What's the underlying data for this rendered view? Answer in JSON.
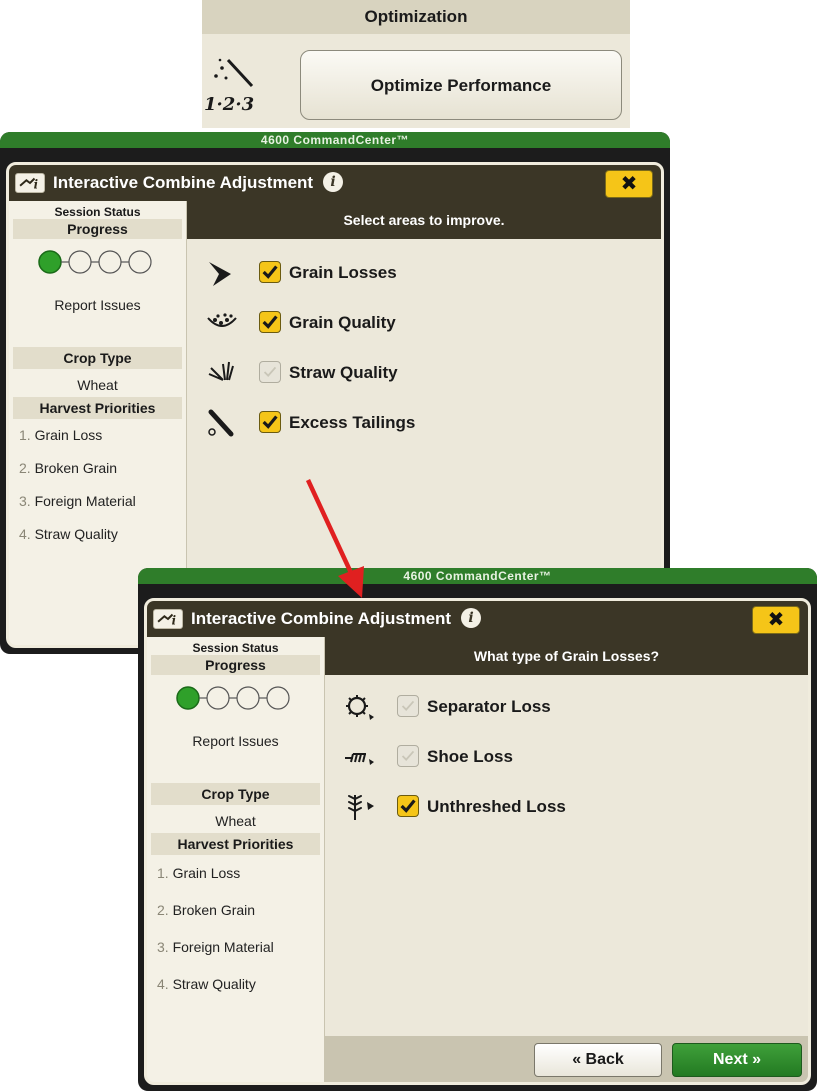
{
  "optimization": {
    "header": "Optimization",
    "button_label": "Optimize Performance",
    "icon": "magic-wand-123-icon",
    "icon_text": "1·2·3"
  },
  "screen1": {
    "commandcenter": "4600 CommandCenter™",
    "title": "Interactive Combine Adjustment",
    "close": "✖",
    "sidebar": {
      "session_status": "Session Status",
      "progress": "Progress",
      "step": "Report Issues",
      "crop_type_label": "Crop Type",
      "crop_type_value": "Wheat",
      "priorities_label": "Harvest Priorities",
      "priorities": [
        {
          "num": "1.",
          "label": "Grain Loss"
        },
        {
          "num": "2.",
          "label": "Broken Grain"
        },
        {
          "num": "3.",
          "label": "Foreign Material"
        },
        {
          "num": "4.",
          "label": "Straw Quality"
        }
      ]
    },
    "prompt": "Select areas to improve.",
    "options": [
      {
        "label": "Grain Losses",
        "checked": true,
        "icon": "grain-losses-icon"
      },
      {
        "label": "Grain Quality",
        "checked": true,
        "icon": "grain-quality-icon"
      },
      {
        "label": "Straw Quality",
        "checked": false,
        "icon": "straw-quality-icon"
      },
      {
        "label": "Excess Tailings",
        "checked": true,
        "icon": "excess-tailings-icon"
      }
    ]
  },
  "screen2": {
    "commandcenter": "4600 CommandCenter™",
    "title": "Interactive Combine Adjustment",
    "close": "✖",
    "sidebar": {
      "session_status": "Session Status",
      "progress": "Progress",
      "step": "Report Issues",
      "crop_type_label": "Crop Type",
      "crop_type_value": "Wheat",
      "priorities_label": "Harvest Priorities",
      "priorities": [
        {
          "num": "1.",
          "label": "Grain Loss"
        },
        {
          "num": "2.",
          "label": "Broken Grain"
        },
        {
          "num": "3.",
          "label": "Foreign Material"
        },
        {
          "num": "4.",
          "label": "Straw Quality"
        }
      ]
    },
    "prompt": "What type of Grain Losses?",
    "options": [
      {
        "label": "Separator Loss",
        "checked": false,
        "icon": "separator-loss-icon"
      },
      {
        "label": "Shoe Loss",
        "checked": false,
        "icon": "shoe-loss-icon"
      },
      {
        "label": "Unthreshed Loss",
        "checked": true,
        "icon": "unthreshed-loss-icon"
      }
    ],
    "back_label": "« Back",
    "next_label": "Next »"
  },
  "colors": {
    "header_dark": "#3b3626",
    "panel_bg": "#ece8da",
    "check_yellow": "#f5c518",
    "jd_green": "#2f7d2a",
    "arrow_red": "#e02020"
  }
}
